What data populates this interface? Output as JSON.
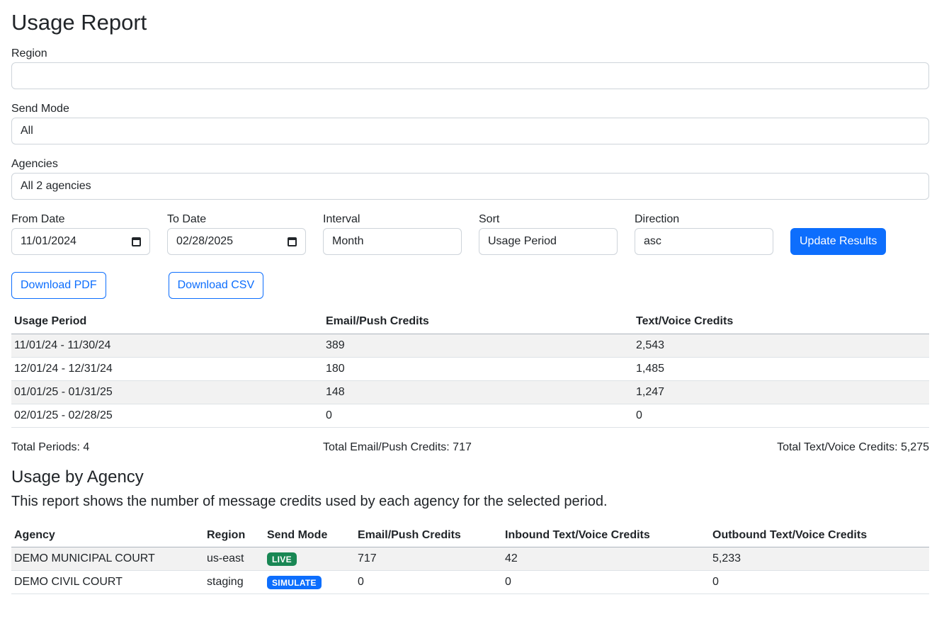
{
  "title": "Usage Report",
  "filters": {
    "region_label": "Region",
    "region_value": "",
    "send_mode_label": "Send Mode",
    "send_mode_value": "All",
    "agencies_label": "Agencies",
    "agencies_value": "All 2 agencies",
    "from_date_label": "From Date",
    "from_date_value": "11/01/2024",
    "to_date_label": "To Date",
    "to_date_value": "02/28/2025",
    "interval_label": "Interval",
    "interval_value": "Month",
    "sort_label": "Sort",
    "sort_value": "Usage Period",
    "direction_label": "Direction",
    "direction_value": "asc",
    "update_button": "Update Results"
  },
  "downloads": {
    "pdf_label": "Download PDF",
    "csv_label": "Download CSV"
  },
  "usage_table": {
    "headers": [
      "Usage Period",
      "Email/Push Credits",
      "Text/Voice Credits"
    ],
    "rows": [
      [
        "11/01/24 - 11/30/24",
        "389",
        "2,543"
      ],
      [
        "12/01/24 - 12/31/24",
        "180",
        "1,485"
      ],
      [
        "01/01/25 - 01/31/25",
        "148",
        "1,247"
      ],
      [
        "02/01/25 - 02/28/25",
        "0",
        "0"
      ]
    ]
  },
  "totals": {
    "periods": "Total Periods: 4",
    "email_push": "Total Email/Push Credits: 717",
    "text_voice": "Total Text/Voice Credits: 5,275"
  },
  "agency_section": {
    "heading": "Usage by Agency",
    "description": "This report shows the number of message credits used by each agency for the selected period.",
    "headers": [
      "Agency",
      "Region",
      "Send Mode",
      "Email/Push Credits",
      "Inbound Text/Voice Credits",
      "Outbound Text/Voice Credits"
    ],
    "rows": [
      [
        "DEMO MUNICIPAL COURT",
        "us-east",
        "LIVE",
        "717",
        "42",
        "5,233"
      ],
      [
        "DEMO CIVIL COURT",
        "staging",
        "SIMULATE",
        "0",
        "0",
        "0"
      ]
    ]
  },
  "colors": {
    "live_badge": "#198754",
    "simulate_badge": "#0d6efd",
    "primary": "#0d6efd"
  }
}
